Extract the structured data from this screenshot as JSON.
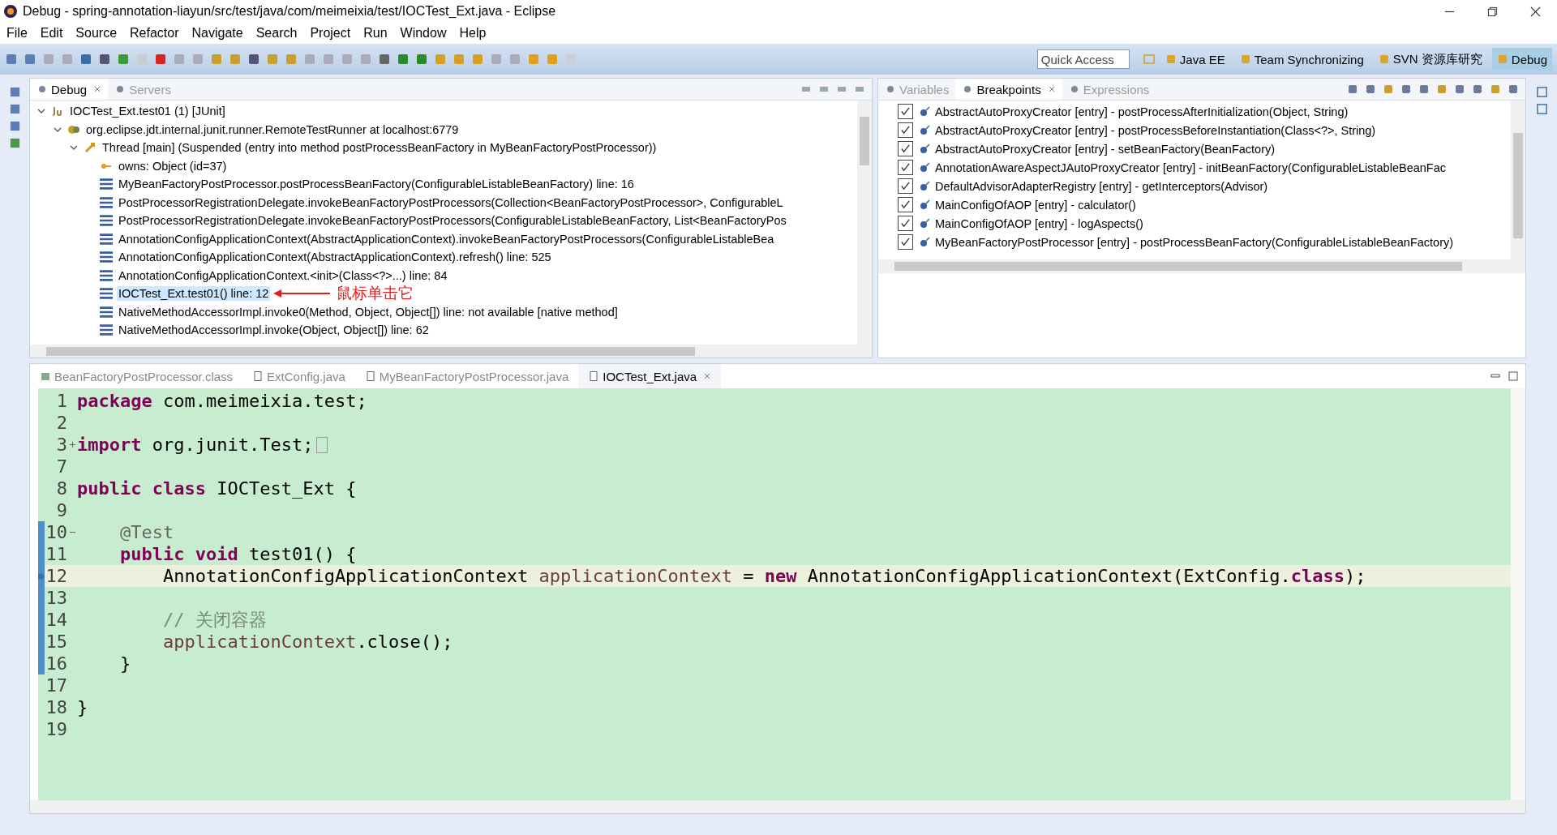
{
  "window": {
    "title": "Debug - spring-annotation-liayun/src/test/java/com/meimeixia/test/IOCTest_Ext.java - Eclipse"
  },
  "menu": [
    "File",
    "Edit",
    "Source",
    "Refactor",
    "Navigate",
    "Search",
    "Project",
    "Run",
    "Window",
    "Help"
  ],
  "quick_access": {
    "placeholder": "Quick Access"
  },
  "perspectives": [
    {
      "label": "Java EE",
      "selected": false
    },
    {
      "label": "Team Synchronizing",
      "selected": false
    },
    {
      "label": "SVN 资源库研究",
      "selected": false
    },
    {
      "label": "Debug",
      "selected": true
    }
  ],
  "debug_view": {
    "tabs": [
      {
        "label": "Debug",
        "selected": true,
        "closable": true
      },
      {
        "label": "Servers",
        "selected": false,
        "closable": false
      }
    ],
    "tree": [
      {
        "label": "IOCTest_Ext.test01 (1) [JUnit]",
        "kind": "launch",
        "expanded": true,
        "children": [
          {
            "label": "org.eclipse.jdt.internal.junit.runner.RemoteTestRunner at localhost:6779",
            "kind": "target",
            "expanded": true,
            "children": [
              {
                "label": "Thread [main] (Suspended (entry into method postProcessBeanFactory in MyBeanFactoryPostProcessor))",
                "kind": "thread",
                "expanded": true,
                "children": [
                  {
                    "label": "owns: Object  (id=37)",
                    "kind": "monitor",
                    "selected": false
                  },
                  {
                    "label": "MyBeanFactoryPostProcessor.postProcessBeanFactory(ConfigurableListableBeanFactory) line: 16",
                    "kind": "frame",
                    "selected": false
                  },
                  {
                    "label": "PostProcessorRegistrationDelegate.invokeBeanFactoryPostProcessors(Collection<BeanFactoryPostProcessor>, ConfigurableL",
                    "kind": "frame",
                    "selected": false
                  },
                  {
                    "label": "PostProcessorRegistrationDelegate.invokeBeanFactoryPostProcessors(ConfigurableListableBeanFactory, List<BeanFactoryPos",
                    "kind": "frame",
                    "selected": false
                  },
                  {
                    "label": "AnnotationConfigApplicationContext(AbstractApplicationContext).invokeBeanFactoryPostProcessors(ConfigurableListableBea",
                    "kind": "frame",
                    "selected": false
                  },
                  {
                    "label": "AnnotationConfigApplicationContext(AbstractApplicationContext).refresh() line: 525",
                    "kind": "frame",
                    "selected": false
                  },
                  {
                    "label": "AnnotationConfigApplicationContext.<init>(Class<?>...) line: 84",
                    "kind": "frame",
                    "selected": false
                  },
                  {
                    "label": "IOCTest_Ext.test01() line: 12",
                    "kind": "frame",
                    "selected": true,
                    "note": "鼠标单击它"
                  },
                  {
                    "label": "NativeMethodAccessorImpl.invoke0(Method, Object, Object[]) line: not available [native method]",
                    "kind": "frame",
                    "selected": false
                  },
                  {
                    "label": "NativeMethodAccessorImpl.invoke(Object, Object[]) line: 62",
                    "kind": "frame",
                    "selected": false
                  }
                ]
              }
            ]
          }
        ]
      }
    ]
  },
  "breakpoints_view": {
    "tabs": [
      {
        "label": "Variables",
        "selected": false,
        "closable": false
      },
      {
        "label": "Breakpoints",
        "selected": true,
        "closable": true
      },
      {
        "label": "Expressions",
        "selected": false,
        "closable": false
      }
    ],
    "items": [
      {
        "label": "AbstractAutoProxyCreator [entry] - postProcessAfterInitialization(Object, String)",
        "checked": true
      },
      {
        "label": "AbstractAutoProxyCreator [entry] - postProcessBeforeInstantiation(Class<?>, String)",
        "checked": true
      },
      {
        "label": "AbstractAutoProxyCreator [entry] - setBeanFactory(BeanFactory)",
        "checked": true
      },
      {
        "label": "AnnotationAwareAspectJAutoProxyCreator [entry] - initBeanFactory(ConfigurableListableBeanFac",
        "checked": true
      },
      {
        "label": "DefaultAdvisorAdapterRegistry [entry] - getInterceptors(Advisor)",
        "checked": true
      },
      {
        "label": "MainConfigOfAOP [entry] - calculator()",
        "checked": true
      },
      {
        "label": "MainConfigOfAOP [entry] - logAspects()",
        "checked": true
      },
      {
        "label": "MyBeanFactoryPostProcessor [entry] - postProcessBeanFactory(ConfigurableListableBeanFactory)",
        "checked": true
      }
    ]
  },
  "editor": {
    "tabs": [
      {
        "label": "BeanFactoryPostProcessor.class",
        "selected": false,
        "kind": "class"
      },
      {
        "label": "ExtConfig.java",
        "selected": false,
        "kind": "java"
      },
      {
        "label": "MyBeanFactoryPostProcessor.java",
        "selected": false,
        "kind": "java"
      },
      {
        "label": "IOCTest_Ext.java",
        "selected": true,
        "kind": "java"
      }
    ],
    "lines": [
      {
        "number": "1",
        "current": false,
        "in_range": false,
        "tokens": [
          {
            "kind": "keyword",
            "text": "package"
          },
          {
            "kind": "plain",
            "text": " com.meimeixia.test;"
          }
        ]
      },
      {
        "number": "2",
        "current": false,
        "in_range": false
      },
      {
        "number": "3",
        "current": false,
        "in_range": false,
        "folded": true,
        "tokens": [
          {
            "kind": "keyword",
            "text": "import"
          },
          {
            "kind": "plain",
            "text": " org.junit.Test;"
          }
        ]
      },
      {
        "number": "7",
        "current": false,
        "in_range": false
      },
      {
        "number": "8",
        "current": false,
        "in_range": false,
        "tokens": [
          {
            "kind": "keyword",
            "text": "public"
          },
          {
            "kind": "keyword",
            "text": " class"
          },
          {
            "kind": "plain",
            "text": " IOCTest_Ext {"
          }
        ],
        "children": [
          {
            "number": "9",
            "current": false,
            "in_range": false
          },
          {
            "number": "10",
            "current": false,
            "in_range": true,
            "folded": false,
            "tokens": [
              {
                "kind": "annotation",
                "text": "@Test"
              }
            ]
          },
          {
            "number": "11",
            "current": false,
            "in_range": true,
            "tokens": [
              {
                "kind": "keyword",
                "text": "public"
              },
              {
                "kind": "keyword",
                "text": " void"
              },
              {
                "kind": "plain",
                "text": " test01() {"
              }
            ],
            "children": [
              {
                "number": "12",
                "current": true,
                "in_range": true,
                "tokens": [
                  {
                    "kind": "plain",
                    "text": "AnnotationConfigApplicationContext "
                  },
                  {
                    "kind": "local",
                    "text": "applicationContext"
                  },
                  {
                    "kind": "plain",
                    "text": " = "
                  },
                  {
                    "kind": "keyword",
                    "text": "new"
                  },
                  {
                    "kind": "plain",
                    "text": " AnnotationConfigApplicationContext(ExtConfig."
                  },
                  {
                    "kind": "keyword",
                    "text": "class"
                  },
                  {
                    "kind": "plain",
                    "text": ");"
                  }
                ]
              },
              {
                "number": "13",
                "current": false,
                "in_range": true
              },
              {
                "number": "14",
                "current": false,
                "in_range": true,
                "tokens": [
                  {
                    "kind": "comment",
                    "text": "// 关闭容器"
                  }
                ]
              },
              {
                "number": "15",
                "current": false,
                "in_range": true,
                "tokens": [
                  {
                    "kind": "local",
                    "text": "applicationContext"
                  },
                  {
                    "kind": "plain",
                    "text": ".close();"
                  }
                ]
              }
            ]
          },
          {
            "number": "16",
            "current": false,
            "in_range": true,
            "tokens": [
              {
                "kind": "plain",
                "text": "}"
              }
            ]
          },
          {
            "number": "17",
            "current": false,
            "in_range": false
          }
        ]
      },
      {
        "number": "18",
        "current": false,
        "in_range": false,
        "tokens": [
          {
            "kind": "plain",
            "text": "}"
          }
        ]
      },
      {
        "number": "19",
        "current": false,
        "in_range": false
      }
    ]
  }
}
